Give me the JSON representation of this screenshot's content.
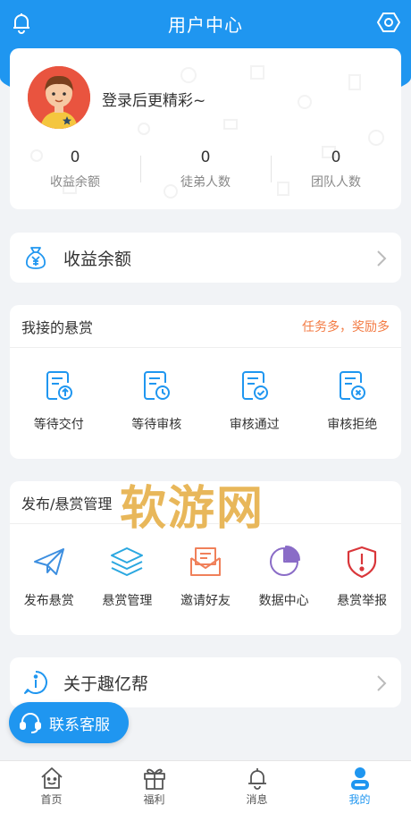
{
  "header": {
    "title": "用户中心",
    "left_icon": "bell-icon",
    "right_icon": "settings-hexagon-icon"
  },
  "profile": {
    "login_prompt": "登录后更精彩~",
    "stats": [
      {
        "value": "0",
        "label": "收益余额"
      },
      {
        "value": "0",
        "label": "徒弟人数"
      },
      {
        "value": "0",
        "label": "团队人数"
      }
    ]
  },
  "balance_row": {
    "label": "收益余额",
    "icon": "money-bag-icon"
  },
  "my_bounties": {
    "title": "我接的悬赏",
    "hint": "任务多，奖励多",
    "items": [
      {
        "label": "等待交付",
        "icon": "upload-doc-icon"
      },
      {
        "label": "等待审核",
        "icon": "clock-doc-icon"
      },
      {
        "label": "审核通过",
        "icon": "check-doc-icon"
      },
      {
        "label": "审核拒绝",
        "icon": "reject-doc-icon"
      }
    ]
  },
  "publish": {
    "title": "发布/悬赏管理",
    "items": [
      {
        "label": "发布悬赏",
        "icon": "paper-plane-icon"
      },
      {
        "label": "悬赏管理",
        "icon": "layers-icon"
      },
      {
        "label": "邀请好友",
        "icon": "envelope-icon"
      },
      {
        "label": "数据中心",
        "icon": "pie-chart-icon"
      },
      {
        "label": "悬赏举报",
        "icon": "shield-alert-icon"
      }
    ]
  },
  "about_row": {
    "label": "关于趣亿帮",
    "icon": "info-icon"
  },
  "watermark": "软游网",
  "service_button": {
    "label": "联系客服",
    "icon": "headset-icon"
  },
  "tabbar": [
    {
      "label": "首页",
      "icon": "home-icon",
      "active": false
    },
    {
      "label": "福利",
      "icon": "gift-icon",
      "active": false
    },
    {
      "label": "消息",
      "icon": "bell-icon",
      "active": false
    },
    {
      "label": "我的",
      "icon": "user-icon",
      "active": true
    }
  ],
  "colors": {
    "primary": "#1f96f0",
    "accent": "#f37b44",
    "background": "#f1f3f6"
  }
}
